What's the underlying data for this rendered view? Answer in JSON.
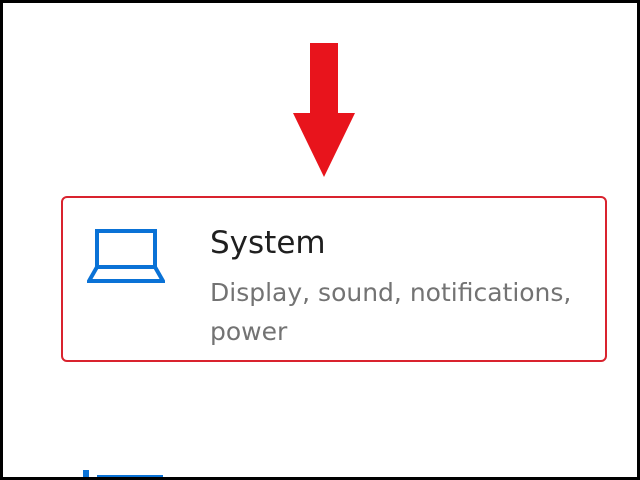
{
  "pointer_arrow": {
    "icon": "down-arrow-icon",
    "color": "#e8141c"
  },
  "system_tile": {
    "icon": "laptop-icon",
    "icon_color": "#0a72d6",
    "highlight_color": "#d9232e",
    "title": "System",
    "description": "Display, sound, notifications, power"
  },
  "next_tile": {
    "icon": "devices-icon",
    "icon_color": "#0a72d6"
  }
}
